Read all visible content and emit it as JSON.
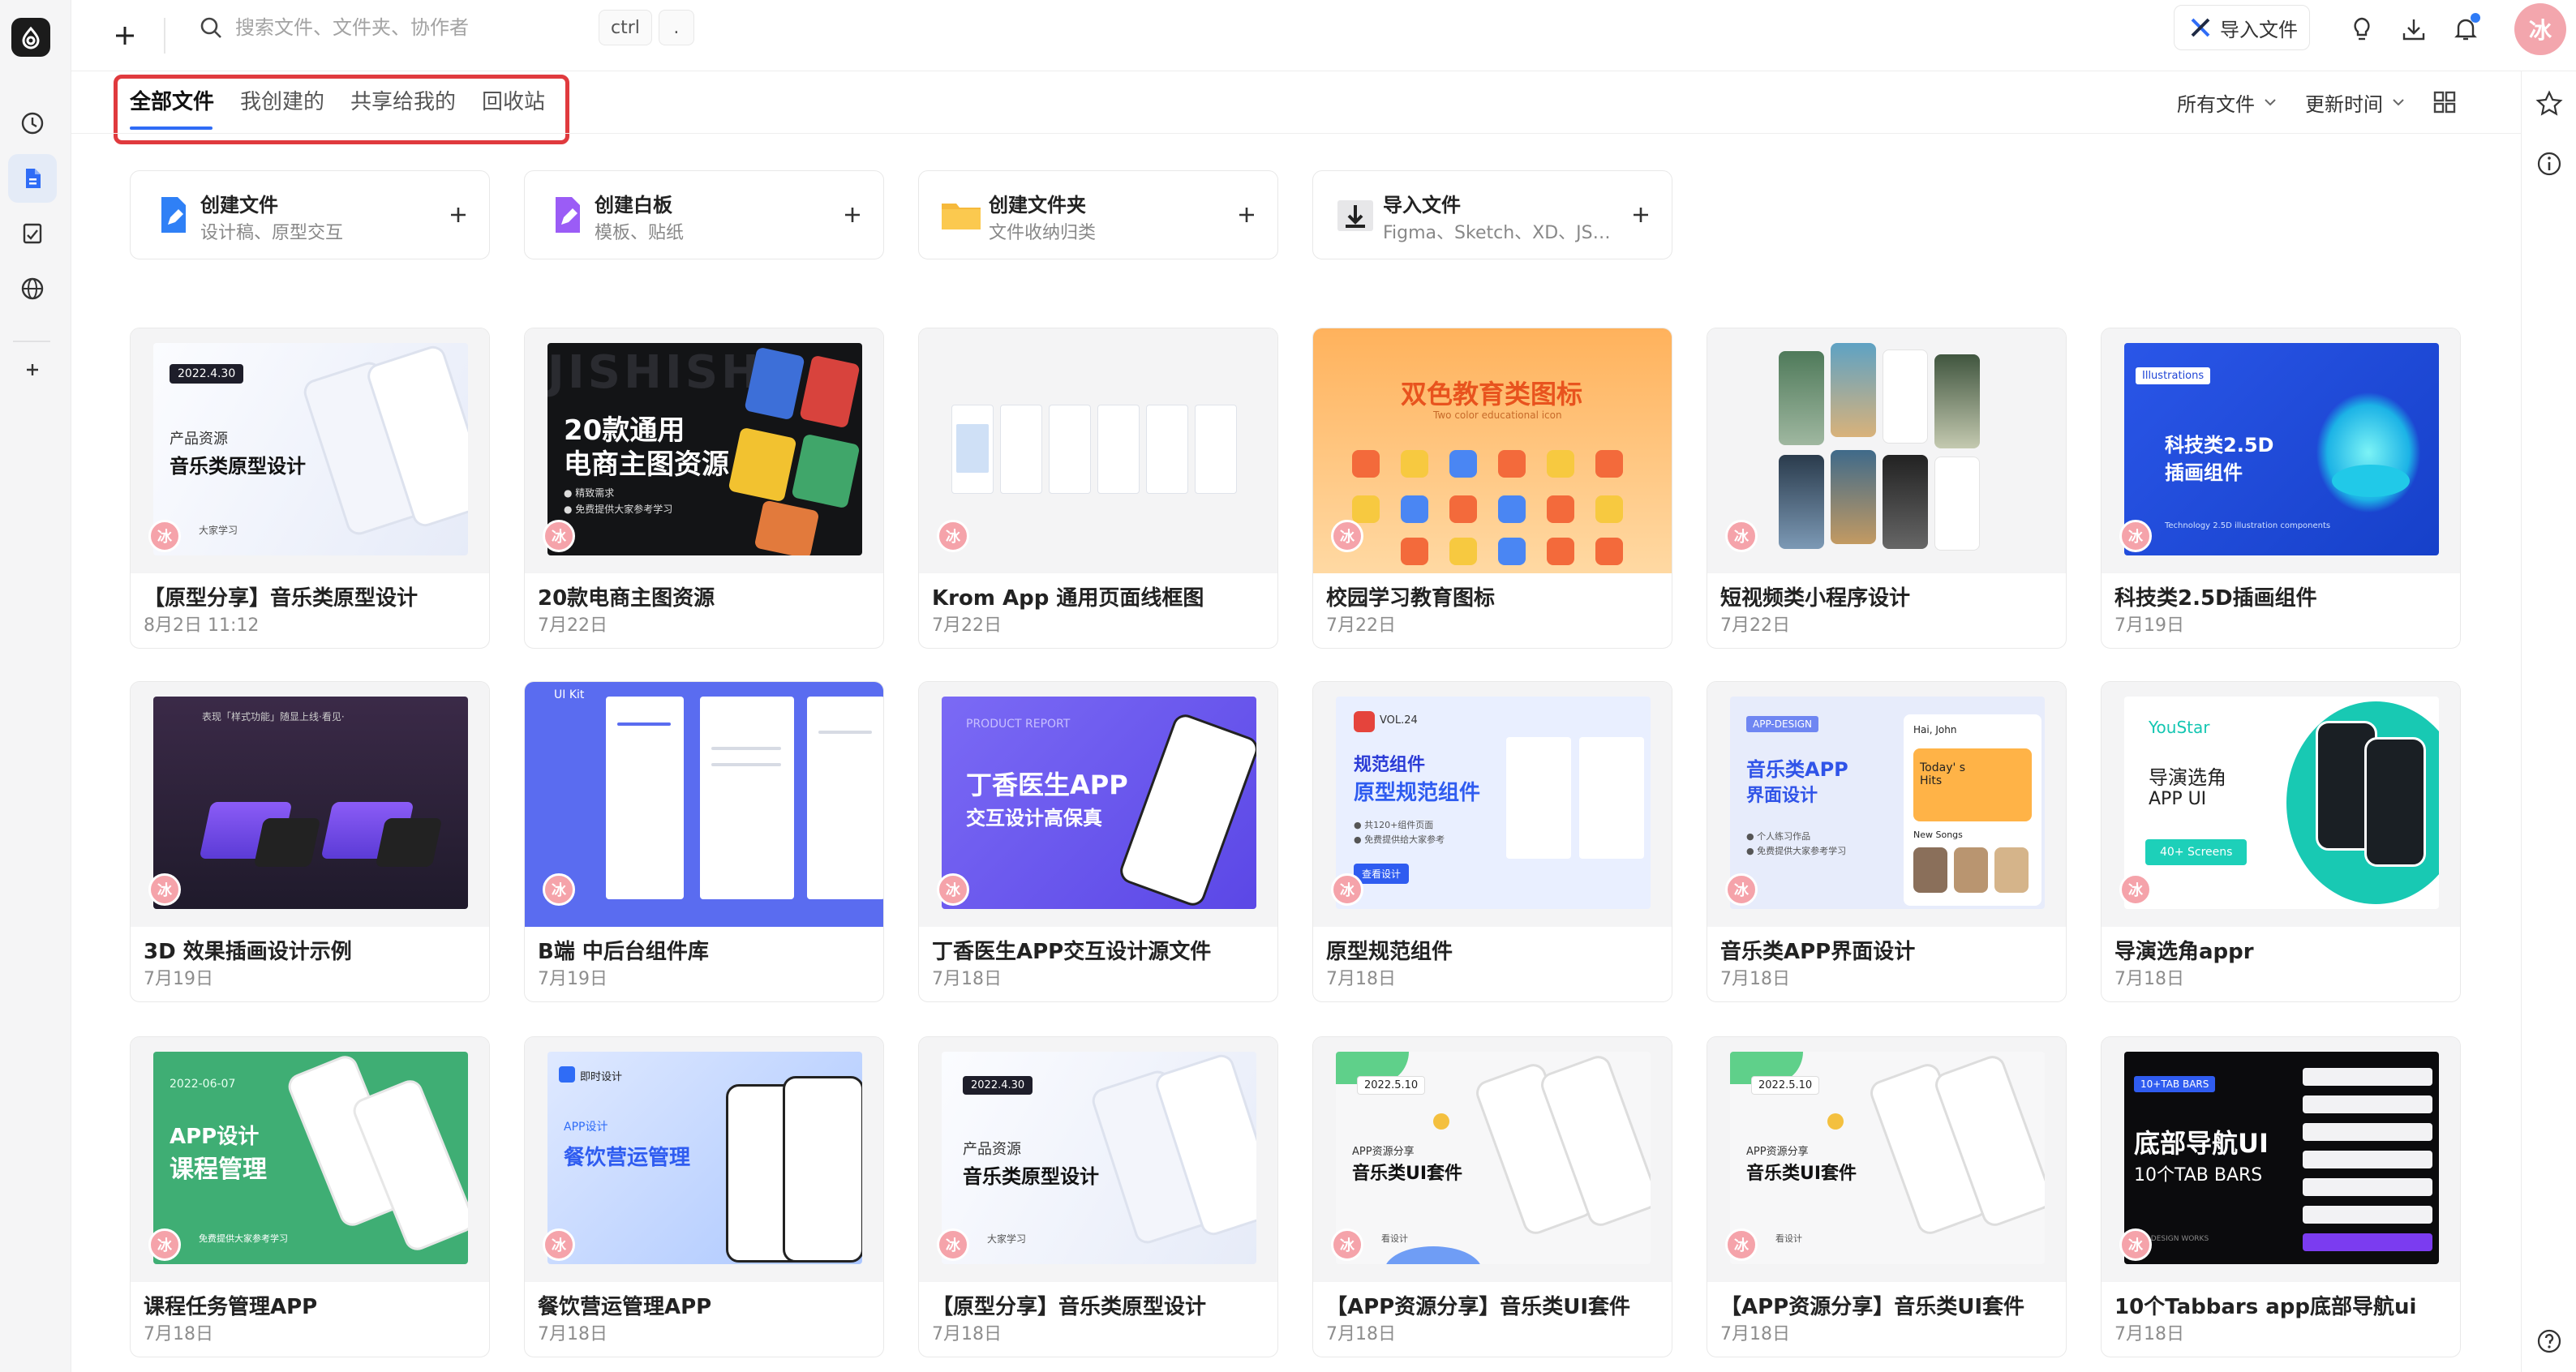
{
  "topbar": {
    "search_placeholder": "搜索文件、文件夹、协作者",
    "shortcut_key": "ctrl",
    "shortcut_dot": ".",
    "import_label": "导入文件",
    "user_initial": "冰"
  },
  "tabs": [
    {
      "label": "全部文件",
      "active": true
    },
    {
      "label": "我创建的",
      "active": false
    },
    {
      "label": "共享给我的",
      "active": false
    },
    {
      "label": "回收站",
      "active": false
    }
  ],
  "filters": {
    "type": "所有文件",
    "sort": "更新时间"
  },
  "create": [
    {
      "title": "创建文件",
      "subtitle": "设计稿、原型交互",
      "icon": "pen-icon",
      "color": "#2f80f6"
    },
    {
      "title": "创建白板",
      "subtitle": "模板、贴纸",
      "icon": "whiteboard-icon",
      "color": "#9b5cf6"
    },
    {
      "title": "创建文件夹",
      "subtitle": "文件收纳归类",
      "icon": "folder-icon",
      "color": "#f6b93b"
    },
    {
      "title": "导入文件",
      "subtitle": "Figma、Sketch、XD、JSD...",
      "icon": "import-icon",
      "color": "#444444"
    }
  ],
  "files": [
    {
      "name": "【原型分享】音乐类原型设计",
      "date": "8月2日 11:12",
      "thumb": {
        "tag": "2022.4.30",
        "line1": "产品资源",
        "line2": "音乐类原型设计",
        "foot": "大家学习"
      }
    },
    {
      "name": "20款电商主图资源",
      "date": "7月22日",
      "thumb": {
        "bg_text": "JISHISHI",
        "line1": "20款通用",
        "line2": "电商主图资源",
        "b1": "● 精致需求",
        "b2": "● 免费提供大家参考学习"
      }
    },
    {
      "name": "Krom App 通用页面线框图",
      "date": "7月22日",
      "thumb": {}
    },
    {
      "name": "校园学习教育图标",
      "date": "7月22日",
      "thumb": {
        "title": "双色教育类图标",
        "sub": "Two color educational icon"
      }
    },
    {
      "name": "短视频类小程序设计",
      "date": "7月22日",
      "thumb": {}
    },
    {
      "name": "科技类2.5D插画组件",
      "date": "7月19日",
      "thumb": {
        "tag": "Illustrations",
        "line1": "科技类2.5D",
        "line2": "插画组件",
        "foot": "Technology 2.5D illustration components"
      }
    },
    {
      "name": "3D 效果插画设计示例",
      "date": "7月19日",
      "thumb": {
        "top": "表现「样式功能」随显上线·看见·"
      }
    },
    {
      "name": "B端 中后台组件库",
      "date": "7月19日",
      "thumb": {
        "tag": "UI Kit"
      }
    },
    {
      "name": "丁香医生APP交互设计源文件",
      "date": "7月18日",
      "thumb": {
        "tag": "PRODUCT REPORT",
        "line1": "丁香医生APP",
        "line2": "交互设计高保真"
      }
    },
    {
      "name": "原型规范组件",
      "date": "7月18日",
      "thumb": {
        "tag": "VOL.24",
        "line1": "规范组件",
        "line2": "原型规范组件",
        "b1": "● 共120+组件页面",
        "b2": "● 免费提供给大家参考",
        "btn": "查看设计"
      }
    },
    {
      "name": "音乐类APP界面设计",
      "date": "7月18日",
      "thumb": {
        "tag": "APP-DESIGN",
        "line1": "音乐类APP",
        "line2": "界面设计",
        "b1": "● 个人练习作品",
        "b2": "● 免费提供大家参考学习",
        "greet": "Hai, John",
        "today": "Today' s Hits",
        "songs": "New Songs"
      }
    },
    {
      "name": "导演选角appr",
      "date": "7月18日",
      "thumb": {
        "brand": "YouStar",
        "line1": "导演选角",
        "line2": "APP UI",
        "btn": "40+ Screens"
      }
    },
    {
      "name": "课程任务管理APP",
      "date": "7月18日",
      "thumb": {
        "tag": "2022-06-07",
        "line1": "APP设计",
        "line2": "课程管理",
        "foot": "免费提供大家参考学习"
      }
    },
    {
      "name": "餐饮营运管理APP",
      "date": "7月18日",
      "thumb": {
        "brand": "即时设计",
        "line1": "APP设计",
        "line2": "餐饮营运管理"
      }
    },
    {
      "name": "【原型分享】音乐类原型设计",
      "date": "7月18日",
      "thumb": {
        "tag": "2022.4.30",
        "line1": "产品资源",
        "line2": "音乐类原型设计",
        "foot": "大家学习"
      }
    },
    {
      "name": "【APP资源分享】音乐类UI套件",
      "date": "7月18日",
      "thumb": {
        "tag": "2022.5.10",
        "line1": "APP资源分享",
        "line2": "音乐类UI套件",
        "foot": "看设计"
      }
    },
    {
      "name": "【APP资源分享】音乐类UI套件",
      "date": "7月18日",
      "thumb": {
        "tag": "2022.5.10",
        "line1": "APP资源分享",
        "line2": "音乐类UI套件",
        "foot": "看设计"
      }
    },
    {
      "name": "10个Tabbars app底部导航ui",
      "date": "7月18日",
      "thumb": {
        "tag": "10+TAB BARS",
        "line1": "底部导航UI",
        "line2": "10个TAB BARS",
        "foot": "NAL DESIGN WORKS"
      }
    }
  ],
  "avatar_initial": "冰",
  "colors": {
    "accent": "#2f6cf6",
    "highlight_border": "#e03a3e",
    "avatar": "#f5a3aa"
  }
}
